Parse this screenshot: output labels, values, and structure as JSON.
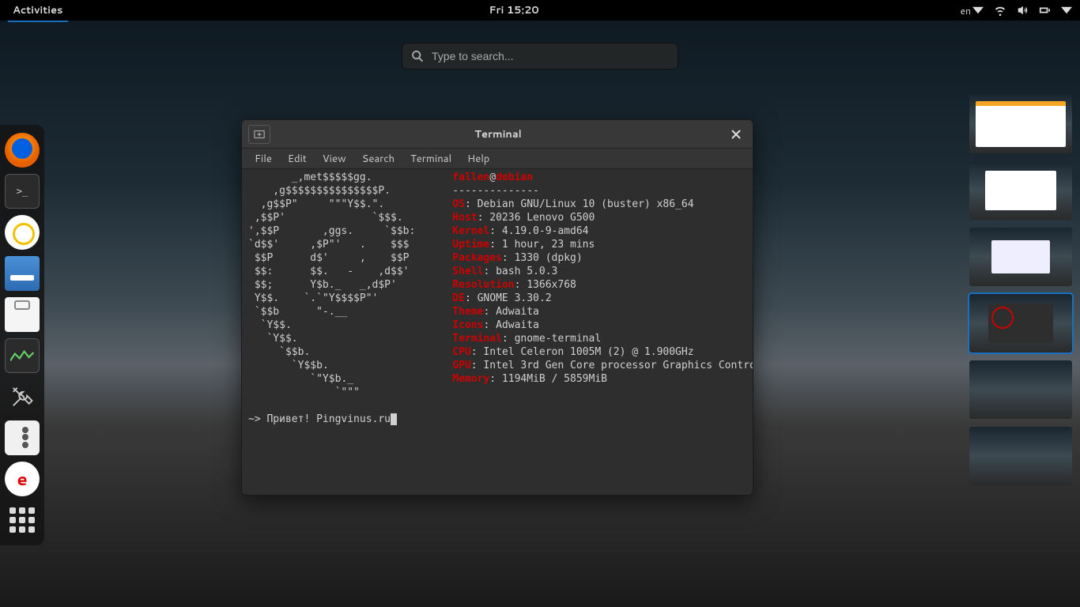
{
  "topbar": {
    "activities": "Activities",
    "clock": "Fri 15:20",
    "lang": "en"
  },
  "search": {
    "placeholder": "Type to search..."
  },
  "window": {
    "title": "Terminal",
    "menubar": [
      "File",
      "Edit",
      "View",
      "Search",
      "Terminal",
      "Help"
    ]
  },
  "neofetch": {
    "user": "fallen",
    "at": "@",
    "host": "debian",
    "ascii": [
      "       _,met$$$$$gg.",
      "    ,g$$$$$$$$$$$$$$$P.",
      "  ,g$$P\"     \"\"\"Y$$.\".",
      " ,$$P'              `$$$.",
      "',$$P       ,ggs.     `$$b:",
      "`d$$'     ,$P\"'   .    $$$",
      " $$P      d$'     ,    $$P",
      " $$:      $$.   -    ,d$$'",
      " $$;      Y$b._   _,d$P'",
      " Y$$.    `.`\"Y$$$$P\"'",
      " `$$b      \"-.__",
      "  `Y$$.",
      "   `Y$$.",
      "     `$$b.",
      "       `Y$$b.",
      "          `\"Y$b._",
      "              `\"\"\""
    ],
    "fields": [
      {
        "label": "OS",
        "value": "Debian GNU/Linux 10 (buster) x86_64"
      },
      {
        "label": "Host",
        "value": "20236 Lenovo G500"
      },
      {
        "label": "Kernel",
        "value": "4.19.0-9-amd64"
      },
      {
        "label": "Uptime",
        "value": "1 hour, 23 mins"
      },
      {
        "label": "Packages",
        "value": "1330 (dpkg)"
      },
      {
        "label": "Shell",
        "value": "bash 5.0.3"
      },
      {
        "label": "Resolution",
        "value": "1366x768"
      },
      {
        "label": "DE",
        "value": "GNOME 3.30.2"
      },
      {
        "label": "Theme",
        "value": "Adwaita"
      },
      {
        "label": "Icons",
        "value": "Adwaita"
      },
      {
        "label": "Terminal",
        "value": "gnome-terminal"
      },
      {
        "label": "CPU",
        "value": "Intel Celeron 1005M (2) @ 1.900GHz"
      },
      {
        "label": "GPU",
        "value": "Intel 3rd Gen Core processor Graphics Contro"
      },
      {
        "label": "Memory",
        "value": "1194MiB / 5859MiB"
      }
    ],
    "underline": "--------------",
    "prompt": "~> Привет! Pingvinus.ru"
  },
  "dash": {
    "items": [
      "firefox",
      "terminal",
      "disks",
      "files",
      "clipboard",
      "system-monitor",
      "tools",
      "tweaks",
      "reader",
      "apps"
    ]
  }
}
